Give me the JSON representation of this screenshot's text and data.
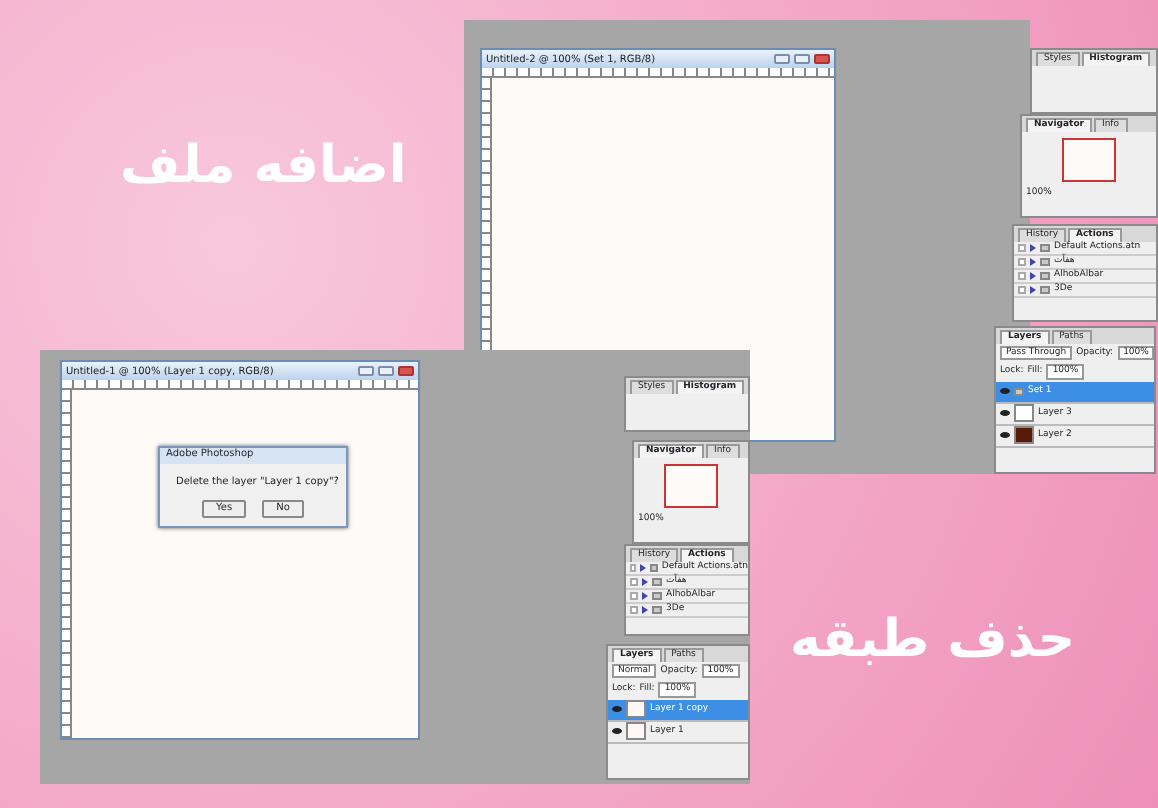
{
  "captions": [
    {
      "text": "اضافه ملف"
    },
    {
      "text": "حذف طبقه"
    }
  ],
  "screenshots": [
    {
      "document": {
        "title": "Untitled-2 @ 100% (Set 1, RGB/8)"
      },
      "styles_panel": {
        "tabs": [
          {
            "label": "Styles",
            "selected": false
          },
          {
            "label": "Histogram",
            "selected": true
          }
        ]
      },
      "navigator_panel": {
        "tabs": [
          {
            "label": "Navigator",
            "selected": true
          },
          {
            "label": "Info",
            "selected": false
          }
        ],
        "zoom": "100%"
      },
      "actions_panel": {
        "tabs": [
          {
            "label": "History",
            "selected": false
          },
          {
            "label": "Actions",
            "selected": true
          }
        ],
        "items": [
          {
            "name": "Default Actions.atn",
            "checked": false
          },
          {
            "name": "هفآت",
            "checked": false
          },
          {
            "name": "AlhobAlbar",
            "checked": false
          },
          {
            "name": "3De",
            "checked": false
          }
        ]
      },
      "layers_panel": {
        "tabs": [
          {
            "label": "Layers",
            "selected": true
          },
          {
            "label": "Paths",
            "selected": false
          }
        ],
        "blend_mode": "Pass Through",
        "opacity_label": "Opacity:",
        "opacity": "100%",
        "lock_label": "Lock:",
        "fill_label": "Fill:",
        "fill": "100%",
        "layers": [
          {
            "name": "Set 1",
            "kind": "group",
            "selected": true,
            "visible": true
          },
          {
            "name": "Layer 3",
            "kind": "layer",
            "selected": false,
            "visible": true,
            "color": "#ffffff"
          },
          {
            "name": "Layer 2",
            "kind": "layer",
            "selected": false,
            "visible": true,
            "color": "#5a1a08"
          }
        ]
      }
    },
    {
      "document": {
        "title": "Untitled-1 @ 100% (Layer 1 copy, RGB/8)"
      },
      "dialog": {
        "title": "Adobe Photoshop",
        "message": "Delete the layer \"Layer 1 copy\"?",
        "buttons": [
          "Yes",
          "No"
        ]
      },
      "styles_panel": {
        "tabs": [
          {
            "label": "Styles",
            "selected": false
          },
          {
            "label": "Histogram",
            "selected": true
          }
        ]
      },
      "navigator_panel": {
        "tabs": [
          {
            "label": "Navigator",
            "selected": true
          },
          {
            "label": "Info",
            "selected": false
          }
        ],
        "zoom": "100%"
      },
      "actions_panel": {
        "tabs": [
          {
            "label": "History",
            "selected": false
          },
          {
            "label": "Actions",
            "selected": true
          }
        ],
        "items": [
          {
            "name": "Default Actions.atn",
            "checked": false
          },
          {
            "name": "هفآت",
            "checked": false
          },
          {
            "name": "AlhobAlbar",
            "checked": false
          },
          {
            "name": "3De",
            "checked": false
          }
        ]
      },
      "layers_panel": {
        "tabs": [
          {
            "label": "Layers",
            "selected": true
          },
          {
            "label": "Paths",
            "selected": false
          }
        ],
        "blend_mode": "Normal",
        "opacity_label": "Opacity:",
        "opacity": "100%",
        "lock_label": "Lock:",
        "fill_label": "Fill:",
        "fill": "100%",
        "layers": [
          {
            "name": "Layer 1 copy",
            "kind": "layer",
            "selected": true,
            "visible": true,
            "color": "#fdf8f6"
          },
          {
            "name": "Layer 1",
            "kind": "layer",
            "selected": false,
            "visible": true,
            "color": "#fdf8f6"
          }
        ]
      }
    }
  ]
}
